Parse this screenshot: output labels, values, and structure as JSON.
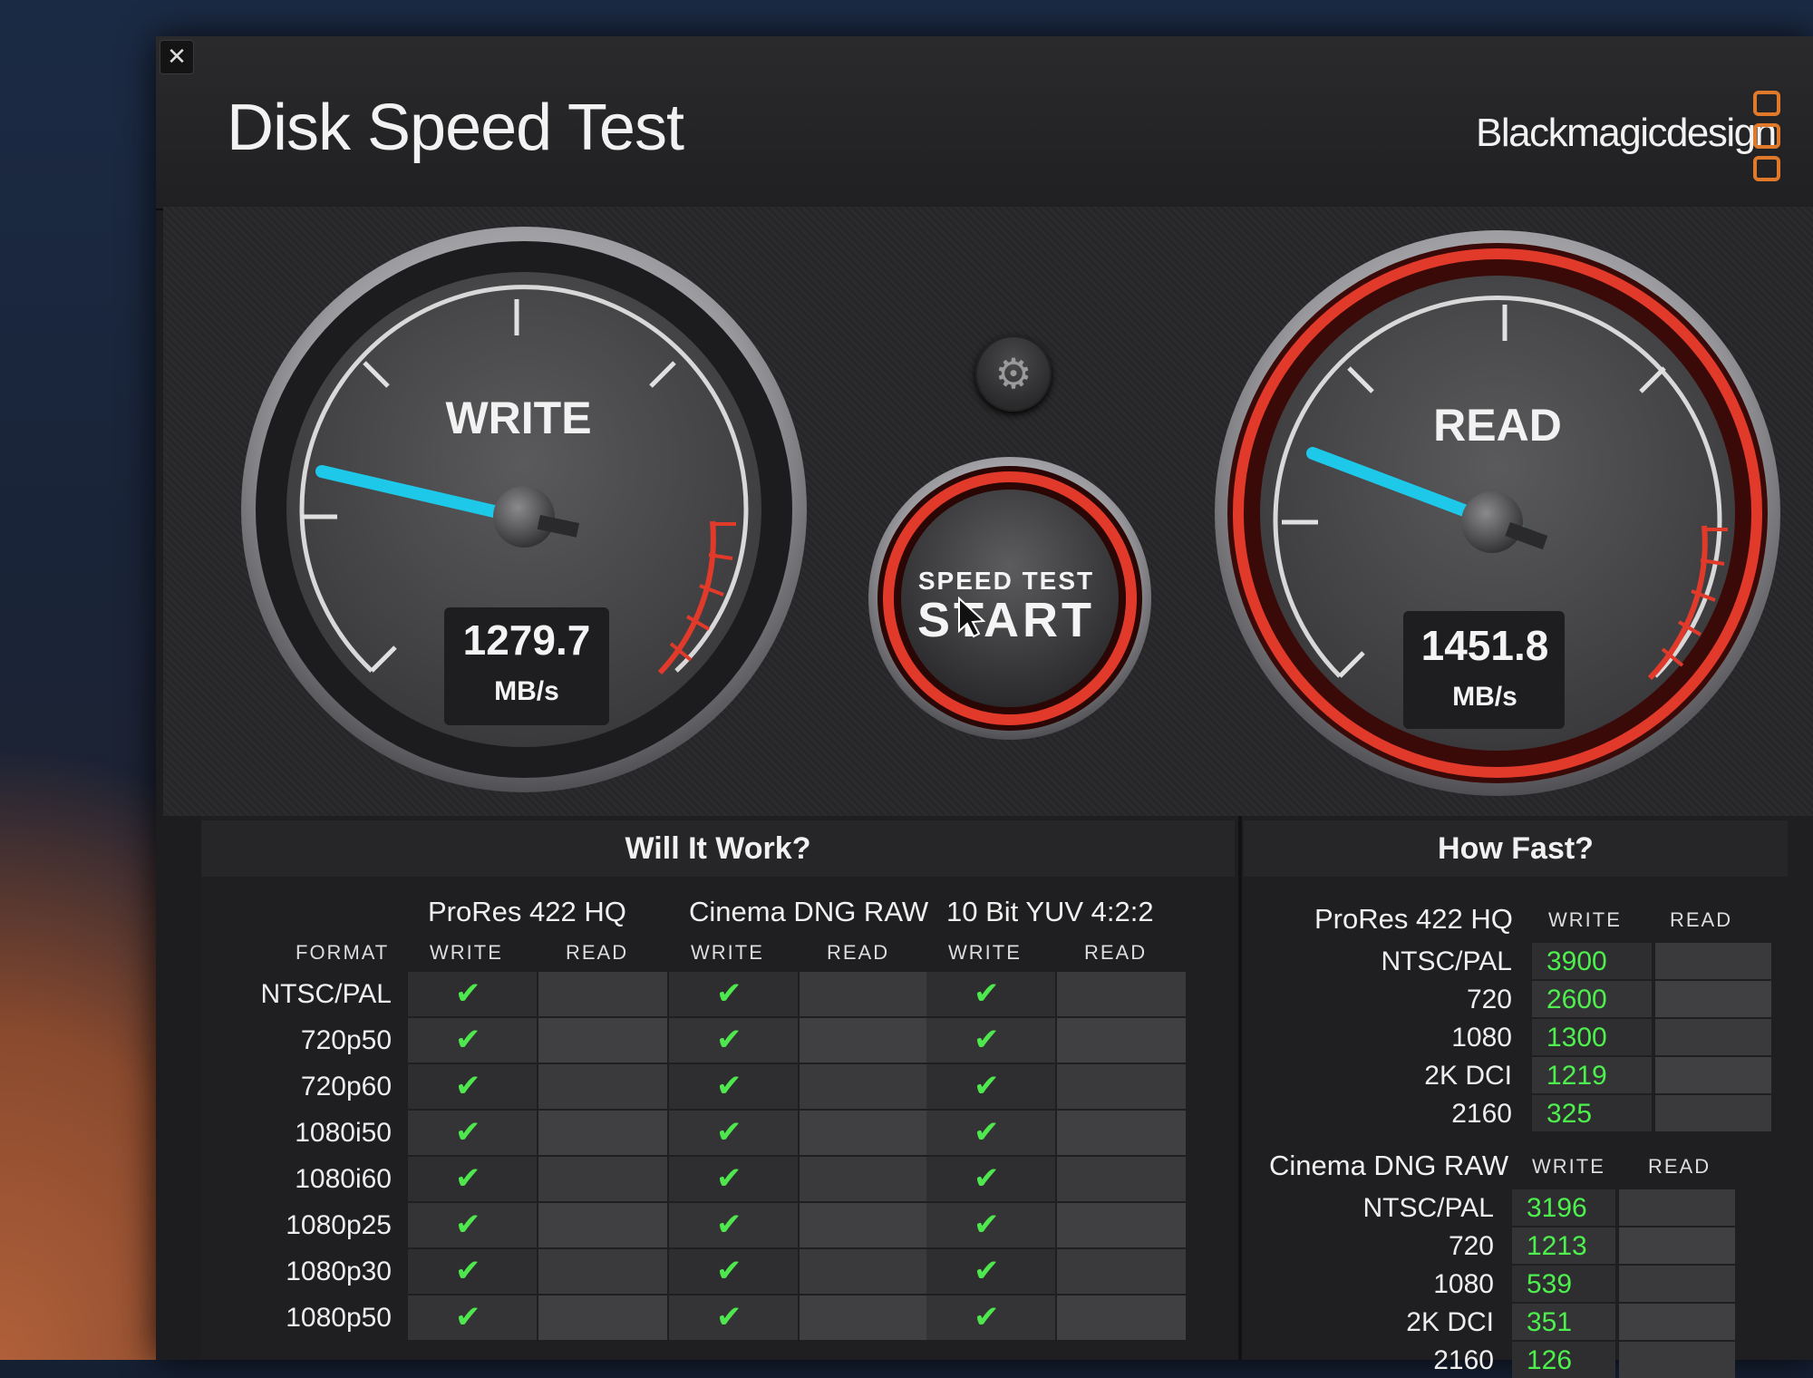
{
  "app": {
    "title": "Disk Speed Test",
    "brand": "Blackmagicdesign",
    "close_label": "✕"
  },
  "write_gauge": {
    "label": "WRITE",
    "value": "1279.7",
    "unit": "MB/s"
  },
  "read_gauge": {
    "label": "READ",
    "value": "1451.8",
    "unit": "MB/s"
  },
  "start_button": {
    "line1": "SPEED TEST",
    "line2": "START"
  },
  "settings": {
    "icon": "gear-icon"
  },
  "will_it_work": {
    "title": "Will It Work?",
    "format_label": "FORMAT",
    "codecs": [
      "ProRes 422 HQ",
      "Cinema DNG RAW",
      "10 Bit YUV 4:2:2"
    ],
    "write_label": "WRITE",
    "read_label": "READ",
    "rows": [
      "NTSC/PAL",
      "720p50",
      "720p60",
      "1080i50",
      "1080i60",
      "1080p25",
      "1080p30",
      "1080p50"
    ],
    "check_glyph": "✔"
  },
  "how_fast": {
    "title": "How Fast?",
    "write_label": "WRITE",
    "read_label": "READ",
    "groups": [
      {
        "codec": "ProRes 422 HQ",
        "rows": [
          {
            "label": "NTSC/PAL",
            "write": "3900"
          },
          {
            "label": "720",
            "write": "2600"
          },
          {
            "label": "1080",
            "write": "1300"
          },
          {
            "label": "2K DCI",
            "write": "1219"
          },
          {
            "label": "2160",
            "write": "325"
          }
        ]
      },
      {
        "codec": "Cinema DNG RAW",
        "rows": [
          {
            "label": "NTSC/PAL",
            "write": "3196"
          },
          {
            "label": "720",
            "write": "1213"
          },
          {
            "label": "1080",
            "write": "539"
          },
          {
            "label": "2K DCI",
            "write": "351"
          },
          {
            "label": "2160",
            "write": "126"
          }
        ]
      }
    ]
  },
  "colors": {
    "needle": "#1ec8e8",
    "accent_red": "#e23a2a",
    "ok_green": "#4ef04e",
    "brand_orange": "#e07a2a"
  }
}
